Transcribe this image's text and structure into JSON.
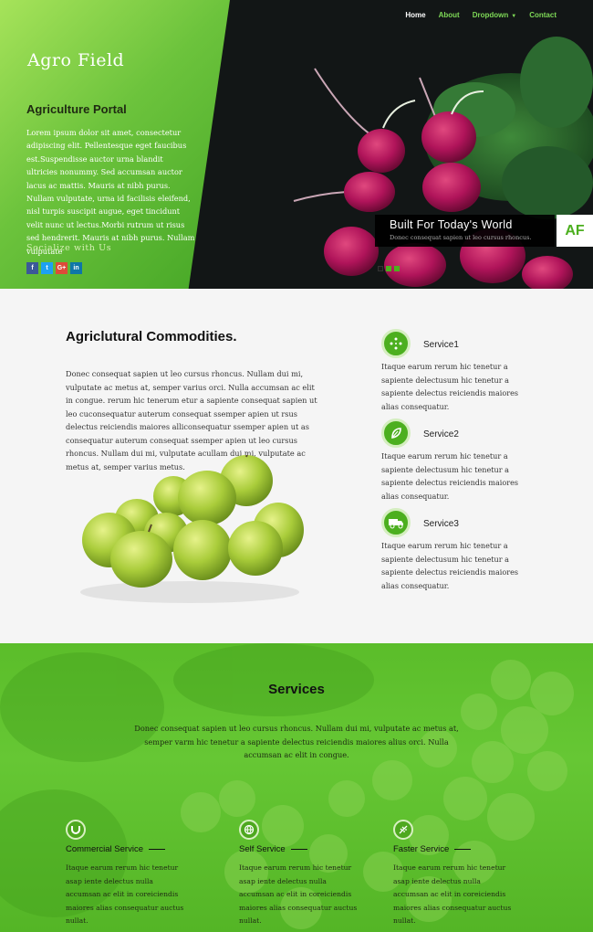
{
  "nav": {
    "items": [
      "Home",
      "About",
      "Dropdown",
      "Contact"
    ],
    "active": "Home"
  },
  "hero": {
    "brand": "Agro Field",
    "panel_title": "Agriculture Portal",
    "panel_text": "Lorem ipsum dolor sit amet, consectetur adipiscing elit. Pellentesque eget faucibus est.Suspendisse auctor urna blandit ultricies nonummy. Sed accumsan auctor lacus ac mattis. Mauris at nibh purus. Nullam vulputate, urna id facilisis eleifend, nisl turpis suscipit augue, eget tincidunt velit nunc ut lectus.Morbi rutrum ut risus sed hendrerit. Mauris at nibh purus. Nullam vulputate",
    "social_title": "Socialize with Us",
    "social": [
      "f",
      "t",
      "G+",
      "in"
    ],
    "caption_title": "Built For Today's World",
    "caption_sub": "Donec consequat sapien ut leo cursus rhoncus.",
    "badge": "AF"
  },
  "commodities": {
    "title": "Agriclutural Commodities.",
    "text": "Donec consequat sapien ut leo cursus rhoncus. Nullam dui mi, vulputate ac metus at, semper varius orci. Nulla accumsan ac elit in congue. rerum hic tenerum etur a sapiente consequat sapien ut leo cuconsequatur auterum consequat ssemper apien ut rsus delectus reiciendis maiores alliconsequatur ssemper apien ut as consequatur auterum consequat ssemper apien ut leo cursus rhoncus. Nullam dui mi, vulputate acullam dui mi, vulputate ac metus at, semper varius metus.",
    "services": [
      {
        "name": "Service1",
        "icon": "dots-circle-icon",
        "text": "Itaque earum rerum hic tenetur a sapiente delectusum hic tenetur a sapiente delectus reiciendis maiores alias consequatur."
      },
      {
        "name": "Service2",
        "icon": "leaf-icon",
        "text": "Itaque earum rerum hic tenetur a sapiente delectusum hic tenetur a sapiente delectus reiciendis maiores alias consequatur."
      },
      {
        "name": "Service3",
        "icon": "truck-icon",
        "text": "Itaque earum rerum hic tenetur a sapiente delectusum hic tenetur a sapiente delectus reiciendis maiores alias consequatur."
      }
    ]
  },
  "services": {
    "title": "Services",
    "text": "Donec consequat sapien ut leo cursus rhoncus. Nullam dui mi, vulputate ac metus at, semper varm hic tenetur a sapiente delectus reiciendis maiores alius orci. Nulla accumsan ac elit in congue.",
    "columns": [
      {
        "name": "Commercial Service",
        "icon": "magnet-icon",
        "text": "Itaque earum rerum hic tenetur asap iente delectus nulla accumsan ac elit in coreiciendis maiores alias consequatur auctus nullat."
      },
      {
        "name": "Self Service",
        "icon": "globe-icon",
        "text": "Itaque earum rerum hic tenetur asap iente delectus nulla accumsan ac elit in coreiciendis maiores alias consequatur auctus nullat."
      },
      {
        "name": "Faster Service",
        "icon": "wheat-icon",
        "text": "Itaque earum rerum hic tenetur asap iente delectus nulla accumsan ac elit in coreiciendis maiores alias consequatur auctus nullat."
      }
    ]
  },
  "colors": {
    "accent": "#4caf1f",
    "nav_link": "#7ed957"
  }
}
